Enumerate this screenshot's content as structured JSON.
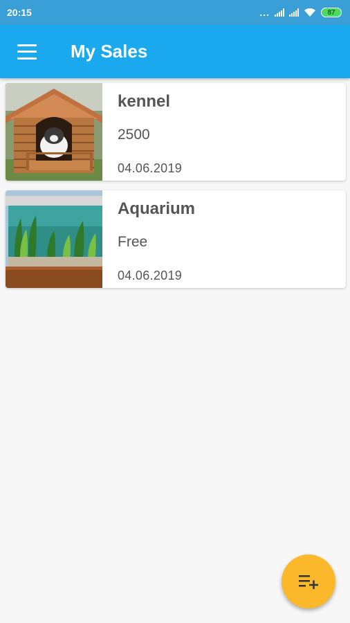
{
  "status_bar": {
    "time": "20:15",
    "battery": "87",
    "dots": "..."
  },
  "app_bar": {
    "title": "My Sales"
  },
  "sales": [
    {
      "title": "kennel",
      "price": "2500",
      "date": "04.06.2019"
    },
    {
      "title": "Aquarium",
      "price": "Free",
      "date": "04.06.2019"
    }
  ],
  "colors": {
    "status_bar": "#3a9fd6",
    "app_bar": "#1aa9ee",
    "fab": "#fbb82b",
    "background": "#f7f7f7"
  },
  "icons": {
    "menu": "hamburger-menu-icon",
    "fab": "playlist-add-icon"
  }
}
